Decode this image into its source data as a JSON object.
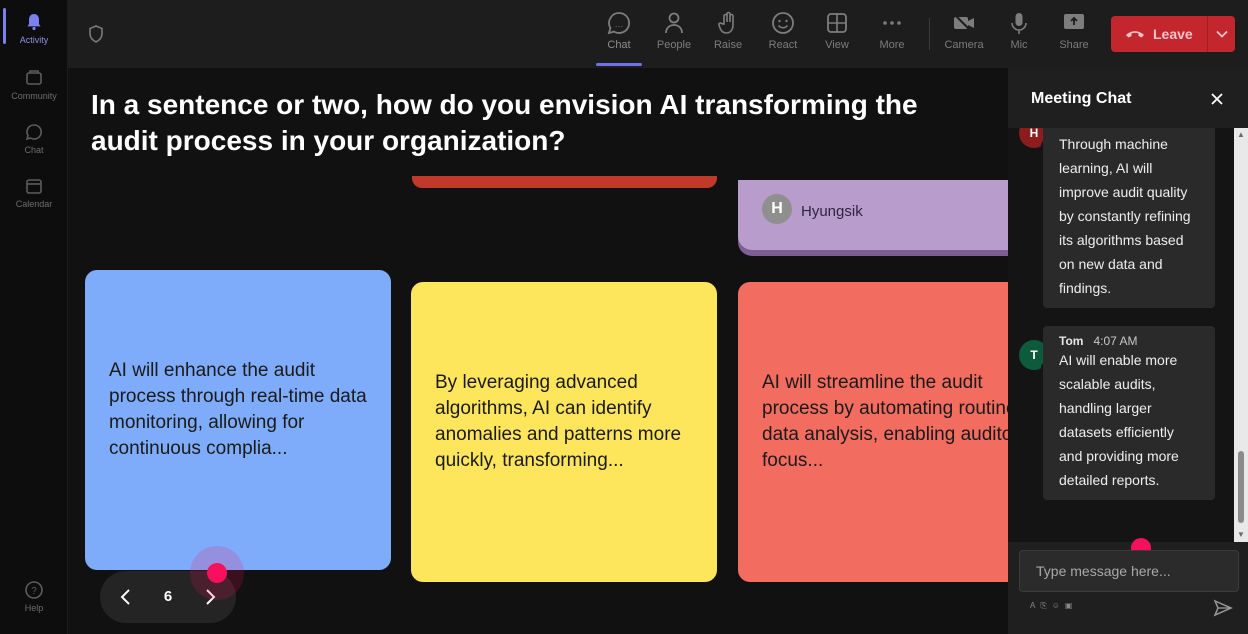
{
  "rail": {
    "items": [
      {
        "label": "Activity",
        "icon": "bell-icon"
      },
      {
        "label": "Community",
        "icon": "community-icon"
      },
      {
        "label": "Chat",
        "icon": "chat-icon"
      },
      {
        "label": "Calendar",
        "icon": "calendar-icon"
      },
      {
        "label": "Help",
        "icon": "help-icon"
      }
    ]
  },
  "toolbar": {
    "chat": "Chat",
    "people": "People",
    "raise": "Raise",
    "react": "React",
    "view": "View",
    "more": "More",
    "camera": "Camera",
    "mic": "Mic",
    "share": "Share",
    "leave": "Leave"
  },
  "stage": {
    "question": "In a sentence or two, how do you envision AI transforming the audit process in your organization?",
    "purple_card_author_initial": "H",
    "purple_card_author": "Hyungsik",
    "cards": [
      {
        "text": "AI will enhance the audit process through real-time data monitoring, allowing for continuous complia..."
      },
      {
        "text": "By leveraging advanced algorithms, AI can identify anomalies and patterns more quickly, transforming..."
      },
      {
        "text": "AI will streamline the audit process by automating routine data analysis, enabling auditors to focus..."
      }
    ],
    "page_number": "6"
  },
  "chat": {
    "title": "Meeting Chat",
    "messages": [
      {
        "initial": "H",
        "text": "Through machine learning, AI will improve audit quality by constantly refining its algorithms based on new data and findings."
      },
      {
        "initial": "T",
        "author": "Tom",
        "time": "4:07 AM",
        "text": "AI will enable more scalable audits, handling larger datasets efficiently and providing more detailed reports."
      }
    ],
    "input_placeholder": "Type message here..."
  },
  "colors": {
    "card_blue": "#7eacfa",
    "card_yellow": "#fde65b",
    "card_red": "#f26c5f",
    "card_purple": "#b89ccc",
    "leave_red": "#c4262e",
    "accent": "#6e72e6"
  }
}
